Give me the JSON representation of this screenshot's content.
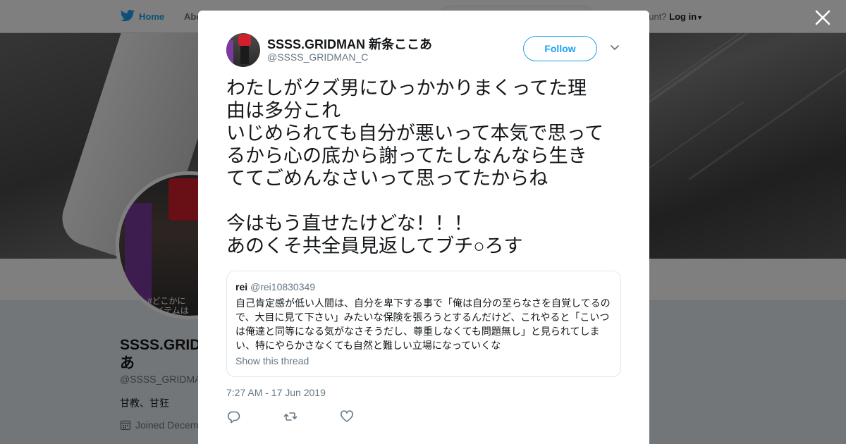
{
  "nav": {
    "home_label": "Home",
    "about_label": "Abo",
    "account_prefix": "ccount?",
    "login_label": "Log in"
  },
  "profile": {
    "name_line1": "SSSS.GRIDM",
    "name_line2": "あ",
    "handle": "@SSSS_GRIDMA",
    "bio": "甘教、甘狂",
    "joined": "Joined Decem",
    "avatar_overlay_line1": "#どこかに",
    "avatar_overlay_line2": "アイテムは"
  },
  "tweet": {
    "author_name": "SSSS.GRIDMAN 新条ここあ",
    "author_handle": "@SSSS_GRIDMAN_C",
    "follow_label": "Follow",
    "text_lines": [
      "わたしがクズ男にひっかかりまくってた理",
      "由は多分これ",
      "いじめられても自分が悪いって本気で思って",
      "るから心の底から謝ってたしなんなら生き",
      "ててごめんなさいって思ってたからね",
      "",
      "今はもう直せたけどな！！！",
      "あのくそ共全員見返してブチ○ろす"
    ],
    "timestamp": "7:27 AM - 17 Jun 2019"
  },
  "quote": {
    "name": "rei",
    "handle": "@rei10830349",
    "text_lines": [
      "自己肯定感が低い人間は、自分を卑下する事で「俺は自分の至らなさを自覚してるの",
      "で、大目に見て下さい」みたいな保険を張ろうとするんだけど、これやると「こいつ",
      "は俺達と同等になる気がなさそうだし、尊重しなくても問題無し」と見られてしま",
      "い、特にやらかさなくても自然と難しい立場になっていくな"
    ],
    "show_thread_label": "Show this thread"
  },
  "icons": {
    "logo": "twitter-bird-icon",
    "close": "close-icon",
    "chevron": "chevron-down-icon",
    "reply": "reply-icon",
    "retweet": "retweet-icon",
    "like": "heart-icon",
    "calendar": "calendar-icon"
  },
  "colors": {
    "brand": "#1da1f2",
    "text": "#14171a",
    "muted": "#657786",
    "border": "#e1e8ed",
    "avatar_purple": "#7a3aa0",
    "avatar_red": "#d31e2d"
  }
}
